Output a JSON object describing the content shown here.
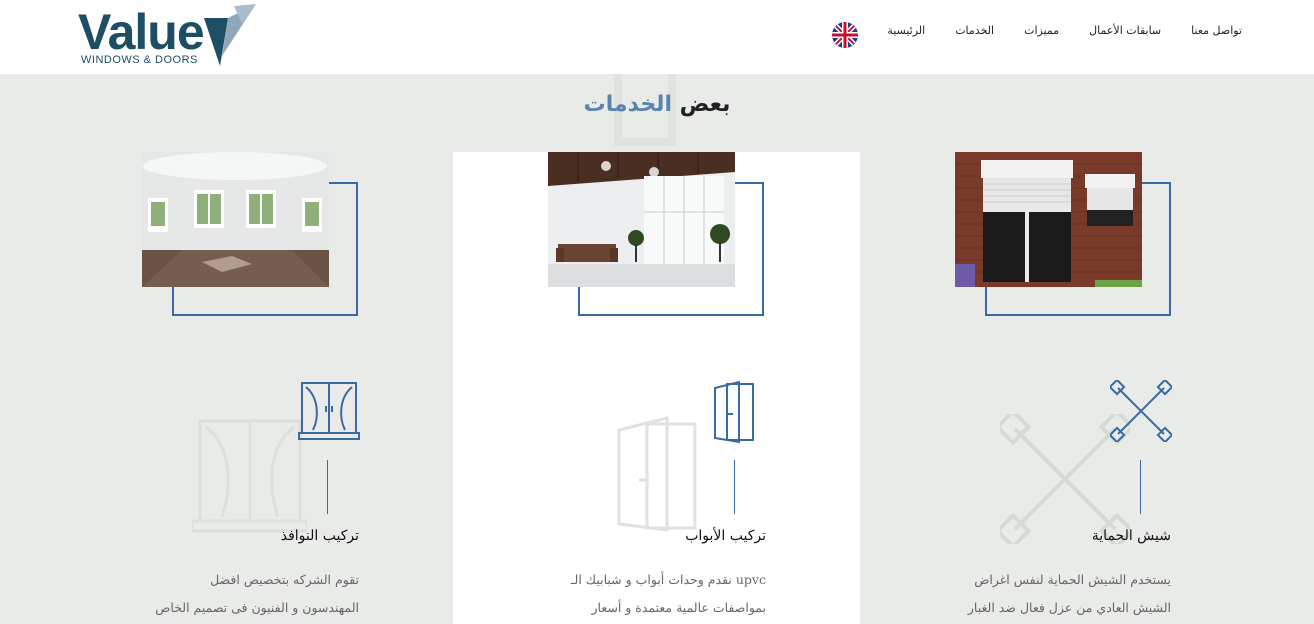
{
  "header": {
    "logo_word": "Value",
    "logo_sub": "WINDOWS & DOORS",
    "language_flag": "uk-flag-icon",
    "nav": [
      {
        "label": "الرئيسية"
      },
      {
        "label": "الخدمات"
      },
      {
        "label": "مميزات"
      },
      {
        "label": "سابقات الأعمال"
      },
      {
        "label": "تواصل معنا"
      }
    ]
  },
  "section": {
    "title_part1": "بعض",
    "title_part2": "الخدمات"
  },
  "cards": [
    {
      "title": "شيش الحماية",
      "desc_line1": "يستخدم الشيش الحماية لنفس اغراض",
      "desc_line2": "الشيش العادي من عزل فعال ضد الغبار",
      "icon": "tools-cross-icon",
      "photo": "rolling-shutter-house-photo"
    },
    {
      "title": "تركيب الأبواب",
      "desc_line1": "upvc نقدم وحدات أبواب و شبابيك الـ",
      "desc_line2": "بمواصفات عالمية معتمدة و أسعار",
      "icon": "door-icon",
      "photo": "bright-room-interior-photo"
    },
    {
      "title": "تركيب النوافذ",
      "desc_line1": "تقوم الشركه بتخصيص افضل",
      "desc_line2": "المهندسون و الفنيون فى تصميم الخاص",
      "icon": "window-icon",
      "photo": "empty-room-windows-photo"
    }
  ],
  "colors": {
    "accent": "#3a6aa2",
    "title_accent": "#5b83ad",
    "background": "#e8ebe7",
    "logo": "#1d4e63"
  }
}
